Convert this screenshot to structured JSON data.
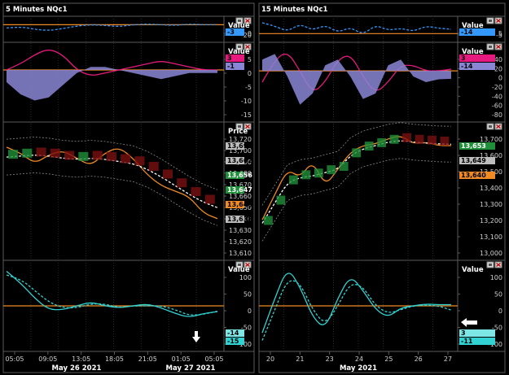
{
  "colors": {
    "background": "#000000",
    "frame": "#5a5a5a",
    "grid": "#2a2a2a",
    "orange": "#f08a24",
    "blue_dash": "#3399ff",
    "magenta": "#e6197e",
    "lavender": "#8a86d6",
    "cyan": "#32d2d2",
    "white": "#ffffff",
    "green": "#1f8f3a",
    "maroon": "#7a1010"
  },
  "panels": [
    {
      "title": "5 Minutes NQc1",
      "x_axis": {
        "time_ticks": [
          "05:05",
          "09:05",
          "13:05",
          "18:05",
          "21:05",
          "01:05",
          "05:05"
        ],
        "date_labels": [
          "May 26 2021",
          "May 27 2021"
        ]
      },
      "rows": [
        {
          "header": "Value",
          "ticks": [
            "0",
            "-20"
          ],
          "tags": [
            {
              "text": "-3",
              "bg": "#3399ff",
              "fg": "#000000"
            }
          ]
        },
        {
          "header": "Value",
          "ticks": [
            "5",
            "0",
            "-5",
            "-10",
            "-15"
          ],
          "tags": [
            {
              "text": "3",
              "bg": "#e6197e",
              "fg": "#000000"
            },
            {
              "text": "-1",
              "bg": "#8a86d6",
              "fg": "#000000"
            }
          ]
        },
        {
          "header": "Price",
          "ticks": [
            "13,720",
            "13,700",
            "13,690",
            "13,680",
            "13,670",
            "13,660",
            "13,650",
            "13,640",
            "13,630",
            "13,620",
            "13,610"
          ],
          "tags": [
            {
              "text": "13,699",
              "bg": "#bdbdbd",
              "fg": "#000000"
            },
            {
              "text": "13,662",
              "bg": "#bdbdbd",
              "fg": "#000000"
            },
            {
              "text": "13,656",
              "bg": "#1f8f3a",
              "fg": "#ffffff"
            },
            {
              "text": "13,647",
              "bg": "#1f8f3a",
              "fg": "#ffffff"
            },
            {
              "text": "13,640",
              "bg": "#f08a24",
              "fg": "#000000"
            },
            {
              "text": "13,638",
              "bg": "#bdbdbd",
              "fg": "#000000"
            }
          ]
        },
        {
          "header": "Value",
          "ticks": [
            "100",
            "50",
            "0",
            "-50",
            "-100"
          ],
          "tags": [
            {
              "text": "-14",
              "bg": "#7fe6e6",
              "fg": "#000000"
            },
            {
              "text": "-15",
              "bg": "#32d2d2",
              "fg": "#000000"
            }
          ]
        }
      ]
    },
    {
      "title": "15 Minutes NQc1",
      "x_axis": {
        "day_ticks": [
          "20",
          "21",
          "23",
          "24",
          "25",
          "26",
          "27"
        ],
        "date_labels": [
          "May 2021"
        ]
      },
      "rows": [
        {
          "header": "Value",
          "ticks": [
            "5",
            "-5"
          ],
          "tags": [
            {
              "text": "-14",
              "bg": "#3399ff",
              "fg": "#000000"
            }
          ]
        },
        {
          "header": "Value",
          "ticks": [
            "40",
            "20",
            "0",
            "-20",
            "-40",
            "-60",
            "-80"
          ],
          "tags": [
            {
              "text": "3",
              "bg": "#e6197e",
              "fg": "#000000"
            },
            {
              "text": "-14",
              "bg": "#8a86d6",
              "fg": "#000000"
            }
          ]
        },
        {
          "header": "",
          "ticks": [
            "13,700",
            "13,600",
            "13,500",
            "13,400",
            "13,300",
            "13,200",
            "13,100",
            "13,000"
          ],
          "tags": [
            {
              "text": "13,653",
              "bg": "#1f8f3a",
              "fg": "#ffffff"
            },
            {
              "text": "13,649",
              "bg": "#bdbdbd",
              "fg": "#000000"
            },
            {
              "text": "13,640",
              "bg": "#f08a24",
              "fg": "#000000"
            }
          ]
        },
        {
          "header": "Value",
          "ticks": [
            "100",
            "50",
            "0",
            "-50",
            "-100"
          ],
          "tags": [
            {
              "text": "3",
              "bg": "#7fe6e6",
              "fg": "#000000"
            },
            {
              "text": "-11",
              "bg": "#32d2d2",
              "fg": "#000000"
            }
          ]
        }
      ]
    }
  ],
  "chart_data": [
    {
      "type": "line",
      "title": "5 Minutes NQc1",
      "subplots": [
        {
          "name": "oscillator-1",
          "ylim": [
            -25,
            5
          ],
          "series": [
            {
              "values": [
                -8,
                -6,
                -10,
                -12,
                -9,
                -5,
                -3,
                -4,
                -6,
                -3,
                -2,
                -3,
                -4,
                -2,
                -3,
                -3
              ],
              "dashed": true
            }
          ],
          "reference_line": -3
        },
        {
          "name": "oscillator-2",
          "ylim": [
            -16,
            8
          ],
          "series": [
            {
              "values": [
                0,
                2,
                5,
                7,
                5,
                0,
                -2,
                -1,
                0,
                1,
                2,
                3,
                2,
                1,
                0,
                0
              ]
            },
            {
              "values": [
                -4,
                -8,
                -10,
                -9,
                -5,
                -1,
                1,
                1,
                0,
                -1,
                -2,
                -3,
                -2,
                -1,
                -1,
                -1
              ],
              "histogram": true
            }
          ],
          "reference_line": 0
        },
        {
          "name": "price",
          "ylim": [
            13605,
            13725
          ],
          "series": [
            {
              "values": [
                13705,
                13700,
                13690,
                13698,
                13702,
                13695,
                13688,
                13700,
                13705,
                13695,
                13680,
                13670,
                13665,
                13660,
                13645,
                13640
              ],
              "color": "orange"
            },
            {
              "values": [
                13696,
                13697,
                13698,
                13697,
                13695,
                13694,
                13695,
                13694,
                13692,
                13690,
                13685,
                13678,
                13670,
                13662,
                13655,
                13650
              ],
              "color": "white",
              "dashed": true
            }
          ]
        },
        {
          "name": "oscillator-3",
          "ylim": [
            -110,
            110
          ],
          "series": [
            {
              "values": [
                90,
                60,
                20,
                -10,
                -10,
                0,
                10,
                0,
                -5,
                0,
                5,
                -5,
                -20,
                -30,
                -20,
                -15
              ]
            },
            {
              "values": [
                80,
                70,
                40,
                10,
                -5,
                -5,
                5,
                5,
                -5,
                0,
                0,
                0,
                -10,
                -25,
                -22,
                -14
              ],
              "dashed": true
            }
          ],
          "reference_line": 0
        }
      ]
    },
    {
      "type": "line",
      "title": "15 Minutes NQc1",
      "subplots": [
        {
          "name": "oscillator-1",
          "ylim": [
            -10,
            8
          ],
          "series": [
            {
              "values": [
                5,
                2,
                -3,
                4,
                -2,
                3,
                -4,
                1,
                -6,
                3,
                -2,
                0,
                -3,
                2,
                0,
                -1
              ],
              "dashed": true
            }
          ],
          "reference_line": -5
        },
        {
          "name": "oscillator-2",
          "ylim": [
            -85,
            45
          ],
          "series": [
            {
              "values": [
                -20,
                20,
                35,
                0,
                -40,
                -20,
                20,
                30,
                -10,
                -40,
                -20,
                10,
                10,
                0,
                0,
                3
              ]
            },
            {
              "values": [
                20,
                30,
                -10,
                -60,
                -40,
                10,
                20,
                -10,
                -50,
                -40,
                10,
                20,
                -10,
                -20,
                -15,
                -14
              ],
              "histogram": true
            }
          ],
          "reference_line": 0
        },
        {
          "name": "price",
          "ylim": [
            12980,
            13760
          ],
          "series": [
            {
              "values": [
                13200,
                13350,
                13500,
                13450,
                13550,
                13400,
                13500,
                13600,
                13640,
                13650,
                13680,
                13700,
                13650,
                13660,
                13640,
                13640
              ],
              "color": "orange"
            },
            {
              "values": [
                13180,
                13300,
                13420,
                13450,
                13460,
                13480,
                13500,
                13580,
                13620,
                13640,
                13660,
                13670,
                13660,
                13655,
                13650,
                13648
              ],
              "color": "white",
              "dashed": true
            }
          ]
        },
        {
          "name": "oscillator-3",
          "ylim": [
            -110,
            110
          ],
          "series": [
            {
              "values": [
                -70,
                20,
                100,
                50,
                -30,
                -60,
                20,
                80,
                40,
                -10,
                -30,
                -5,
                0,
                5,
                3,
                3
              ]
            },
            {
              "values": [
                -90,
                -10,
                70,
                60,
                -10,
                -50,
                0,
                60,
                50,
                0,
                -20,
                -10,
                0,
                2,
                0,
                -11
              ],
              "dashed": true
            }
          ],
          "reference_line": 0
        }
      ]
    }
  ]
}
